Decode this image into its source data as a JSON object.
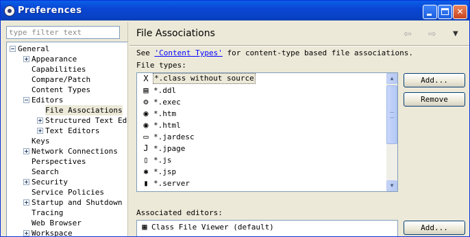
{
  "window": {
    "title": "Preferences"
  },
  "filter": {
    "placeholder": "type filter text"
  },
  "tree": [
    {
      "label": "General",
      "level": 0,
      "expander": "minus"
    },
    {
      "label": "Appearance",
      "level": 1,
      "expander": "plus"
    },
    {
      "label": "Capabilities",
      "level": 1,
      "expander": "none"
    },
    {
      "label": "Compare/Patch",
      "level": 1,
      "expander": "none"
    },
    {
      "label": "Content Types",
      "level": 1,
      "expander": "none"
    },
    {
      "label": "Editors",
      "level": 1,
      "expander": "minus"
    },
    {
      "label": "File Associations",
      "level": 2,
      "expander": "none",
      "selected": true
    },
    {
      "label": "Structured Text Ed",
      "level": 2,
      "expander": "plus"
    },
    {
      "label": "Text Editors",
      "level": 2,
      "expander": "plus"
    },
    {
      "label": "Keys",
      "level": 1,
      "expander": "none"
    },
    {
      "label": "Network Connections",
      "level": 1,
      "expander": "plus"
    },
    {
      "label": "Perspectives",
      "level": 1,
      "expander": "none"
    },
    {
      "label": "Search",
      "level": 1,
      "expander": "none"
    },
    {
      "label": "Security",
      "level": 1,
      "expander": "plus"
    },
    {
      "label": "Service Policies",
      "level": 1,
      "expander": "none"
    },
    {
      "label": "Startup and Shutdown",
      "level": 1,
      "expander": "plus"
    },
    {
      "label": "Tracing",
      "level": 1,
      "expander": "none"
    },
    {
      "label": "Web Browser",
      "level": 1,
      "expander": "none"
    },
    {
      "label": "Workspace",
      "level": 1,
      "expander": "plus"
    }
  ],
  "page": {
    "title": "File Associations",
    "see_prefix": "See ",
    "see_link": "'Content Types'",
    "see_suffix": " for content-type based file associations.",
    "file_types_label": "File types:",
    "assoc_label": "Associated editors:"
  },
  "file_types": [
    {
      "icon": "class-file-icon",
      "glyph": "X",
      "label": "*.class without source",
      "selected": true
    },
    {
      "icon": "ddl-file-icon",
      "glyph": "▤",
      "label": "*.ddl"
    },
    {
      "icon": "exec-file-icon",
      "glyph": "⚙",
      "label": "*.exec"
    },
    {
      "icon": "web-file-icon",
      "glyph": "◉",
      "label": "*.htm"
    },
    {
      "icon": "web-file-icon",
      "glyph": "◉",
      "label": "*.html"
    },
    {
      "icon": "jar-file-icon",
      "glyph": "▭",
      "label": "*.jardesc"
    },
    {
      "icon": "jpage-file-icon",
      "glyph": "J",
      "label": "*.jpage"
    },
    {
      "icon": "js-file-icon",
      "glyph": "▯",
      "label": "*.js"
    },
    {
      "icon": "jsp-file-icon",
      "glyph": "✱",
      "label": "*.jsp"
    },
    {
      "icon": "server-file-icon",
      "glyph": "▮",
      "label": "*.server"
    }
  ],
  "buttons": {
    "add_types": "Add...",
    "remove": "Remove",
    "add_editors": "Add..."
  },
  "editors": [
    {
      "icon": "binary-file-icon",
      "glyph": "▦",
      "label": "Class File Viewer (default)"
    }
  ],
  "nav": {
    "back": "⇦",
    "forward": "⇨",
    "menu": "▼"
  }
}
